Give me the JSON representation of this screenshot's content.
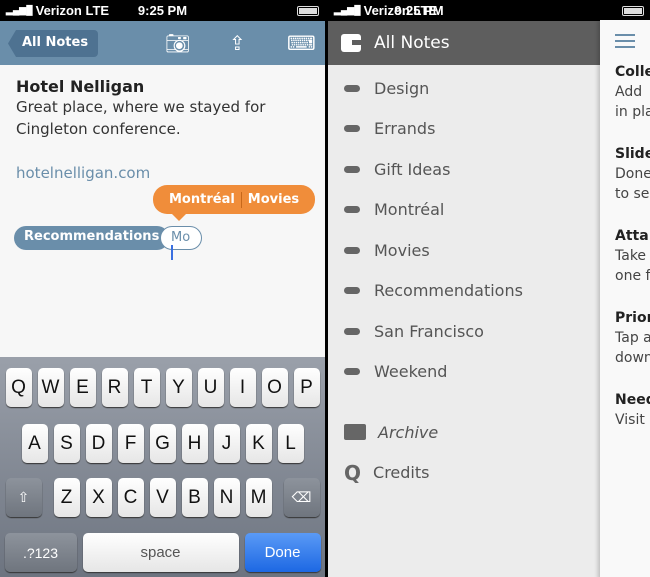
{
  "status": {
    "carrier": "Verizon",
    "network": "LTE",
    "time": "9:25 PM"
  },
  "editor": {
    "back_label": "All Notes",
    "icons": [
      "camera-icon",
      "share-icon",
      "keyboard-dismiss-icon"
    ],
    "title": "Hotel Nelligan",
    "body_line1": "Great place, where we stayed for",
    "body_line2": "Cingleton conference.",
    "link": "hotelnelligan.com",
    "suggestions": [
      "Montréal",
      "Movies"
    ],
    "tags": [
      "Recommendations"
    ],
    "tag_input": "Mo",
    "accent": "#6a8eaa",
    "suggest_color": "#f08d3a"
  },
  "keyboard": {
    "row1": [
      "Q",
      "W",
      "E",
      "R",
      "T",
      "Y",
      "U",
      "I",
      "O",
      "P"
    ],
    "row2": [
      "A",
      "S",
      "D",
      "F",
      "G",
      "H",
      "J",
      "K",
      "L"
    ],
    "row3": [
      "Z",
      "X",
      "C",
      "V",
      "B",
      "N",
      "M"
    ],
    "shift": "⇧",
    "delete": "⌫",
    "numbers": ".?123",
    "space": "space",
    "done": "Done"
  },
  "menu": {
    "all_notes": "All Notes",
    "tags": [
      "Design",
      "Errands",
      "Gift Ideas",
      "Montréal",
      "Movies",
      "Recommendations",
      "San Francisco",
      "Weekend"
    ],
    "archive": "Archive",
    "credits": "Credits"
  },
  "peek": {
    "lines": [
      {
        "title": "Colle",
        "l1": "Add",
        "l2": "in pla"
      },
      {
        "title": "Slide",
        "l1": "Done",
        "l2": "to se"
      },
      {
        "title": "Atta",
        "l1": "Take",
        "l2": "one f"
      },
      {
        "title": "Prior",
        "l1": "Tap a",
        "l2": "down"
      },
      {
        "title": "Need",
        "l1": "Visit",
        "l2": ""
      }
    ]
  }
}
